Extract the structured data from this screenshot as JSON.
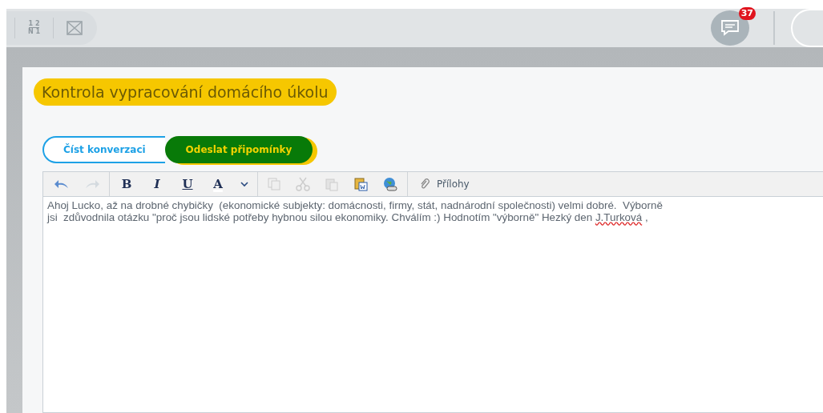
{
  "topbar": {
    "fraction_icon": {
      "top": "1 2",
      "bottom": "N 1"
    },
    "messages_badge": "37"
  },
  "title": "Kontrola vypracování domácího úkolu",
  "tabs": [
    {
      "label": "Číst konverzaci",
      "selected": false
    },
    {
      "label": "Odeslat připomínky",
      "selected": true
    }
  ],
  "editor": {
    "toolbar": [
      {
        "kind": "undo",
        "disabled": false
      },
      {
        "kind": "redo",
        "disabled": true
      },
      {
        "kind": "sep"
      },
      {
        "kind": "bold",
        "label": "B"
      },
      {
        "kind": "italic",
        "label": "I"
      },
      {
        "kind": "underline",
        "label": "U"
      },
      {
        "kind": "color",
        "label": "A"
      },
      {
        "kind": "caret"
      },
      {
        "kind": "sep"
      },
      {
        "kind": "copy",
        "disabled": true
      },
      {
        "kind": "cut",
        "disabled": true
      },
      {
        "kind": "paste",
        "disabled": true
      },
      {
        "kind": "paste-word",
        "disabled": false
      },
      {
        "kind": "link",
        "disabled": false
      },
      {
        "kind": "sep"
      },
      {
        "kind": "attach",
        "label": "Přílohy"
      }
    ],
    "lines": [
      {
        "text": "Ahoj Lucko, až na drobné chybičky  (ekonomické subjekty: domácnosti, firmy, stát, nadnárodní společnosti) velmi dobré.  Výborně"
      },
      {
        "text": "jsi  zdůvodnila otázku \"proč jsou lidské potřeby hybnou silou ekonomiky. Chválím :) Hodnotím \"výborně\" Hezký den ",
        "misspelled": "J.Turková",
        "after": " ,"
      }
    ]
  }
}
